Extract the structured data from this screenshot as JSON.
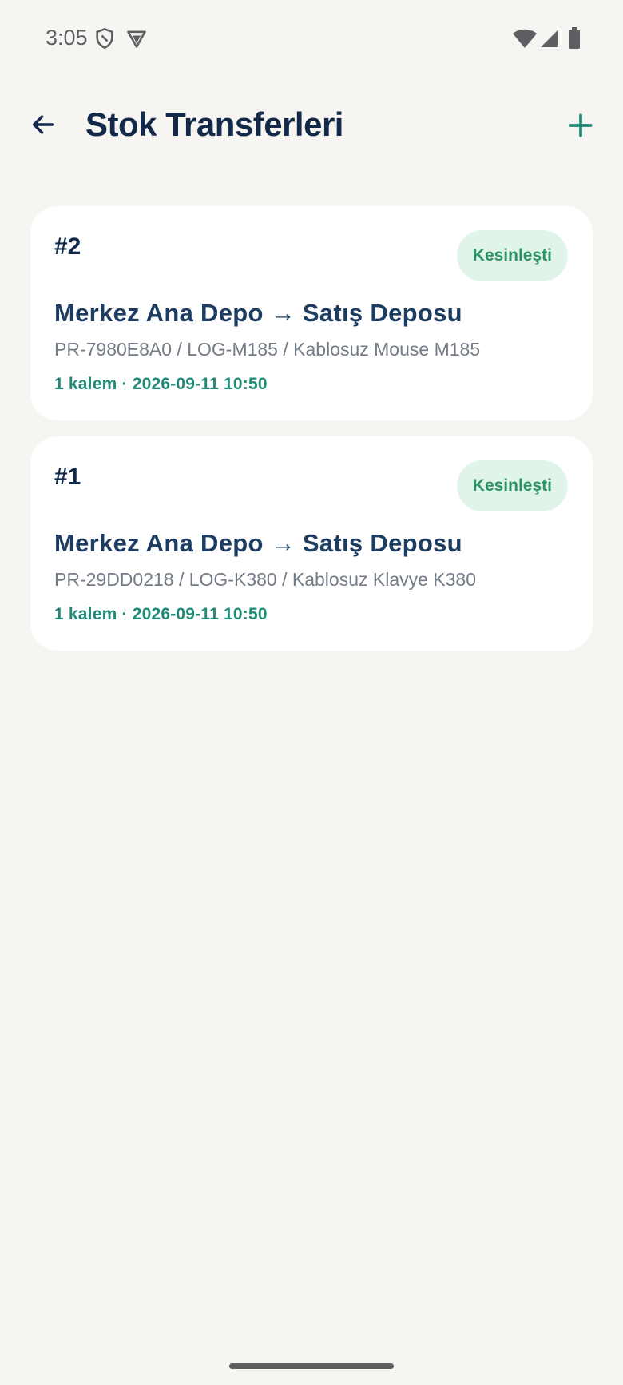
{
  "status_bar": {
    "time": "3:05",
    "left_icons": [
      "shield-icon",
      "vpn-icon"
    ],
    "right_icons": [
      "wifi-icon",
      "signal-icon",
      "battery-icon"
    ]
  },
  "app_bar": {
    "title": "Stok Transferleri",
    "back_icon": "arrow-back-icon",
    "add_icon": "plus-icon"
  },
  "colors": {
    "background": "#f6f5f1",
    "title": "#12294a",
    "accent": "#1f8a76",
    "badge_bg": "#e1f4ea",
    "badge_text": "#2b9464"
  },
  "transfers": [
    {
      "id": "#2",
      "status": "Kesinleşti",
      "route": "Merkez Ana Depo → Satış Deposu",
      "details": "PR-7980E8A0 / LOG-M185 / Kablosuz Mouse M185",
      "meta": "1 kalem · 2026-09-11 10:50"
    },
    {
      "id": "#1",
      "status": "Kesinleşti",
      "route": "Merkez Ana Depo → Satış Deposu",
      "details": "PR-29DD0218 / LOG-K380 / Kablosuz Klavye K380",
      "meta": "1 kalem · 2026-09-11 10:50"
    }
  ]
}
